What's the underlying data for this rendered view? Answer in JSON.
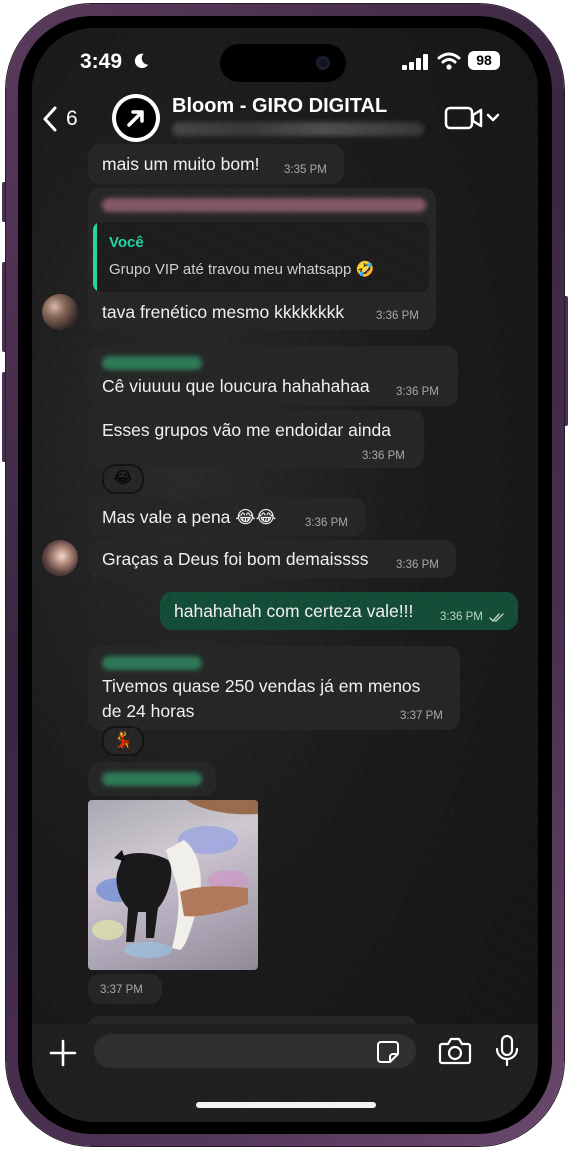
{
  "status_bar": {
    "time": "3:49",
    "battery": "98"
  },
  "header": {
    "back_count": "6",
    "group_name": "Bloom - GIRO DIGITAL"
  },
  "messages": {
    "m1": {
      "text": "mais um muito bom!",
      "time": "3:35 PM"
    },
    "m2": {
      "quote_author": "Você",
      "quote_text": "Grupo VIP até travou meu whatsapp 🤣",
      "text": "tava frenético mesmo kkkkkkkk",
      "time": "3:36 PM"
    },
    "m3": {
      "text": "Cê viuuuu que loucura hahahahaa",
      "time": "3:36 PM"
    },
    "m4": {
      "text": "Esses grupos vão me endoidar ainda",
      "time": "3:36 PM",
      "reaction": "😂"
    },
    "m5": {
      "text": "Mas vale a pena 😂😂",
      "time": "3:36 PM"
    },
    "m6": {
      "text": "Graças a Deus foi bom demaissss",
      "time": "3:36 PM"
    },
    "m7": {
      "text": "hahahahah com certeza vale!!!",
      "time": "3:36 PM"
    },
    "m8": {
      "line1": "Tivemos quase 250 vendas já em menos",
      "line2": "de 24 horas",
      "time": "3:37 PM",
      "reaction": "💃"
    },
    "m9": {
      "time": "3:37 PM"
    }
  },
  "input": {
    "placeholder": ""
  },
  "colors": {
    "incoming_bubble": "#262626",
    "outgoing_bubble": "#144d37",
    "accent": "#25d3a6"
  }
}
